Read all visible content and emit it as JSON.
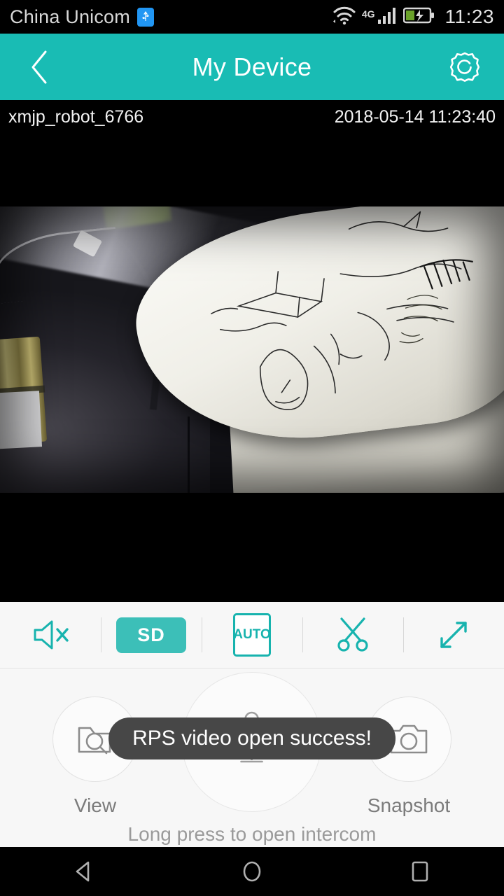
{
  "statusbar": {
    "carrier": "China Unicom",
    "usb_icon": "usb-icon",
    "wifi_icon": "wifi-icon",
    "network_type": "4G",
    "signal_icon": "cellular-signal-icon",
    "battery_icon": "battery-charging-icon",
    "clock": "11:23"
  },
  "header": {
    "back_icon": "back-chevron-icon",
    "title": "My Device",
    "settings_icon": "gear-icon",
    "accent_color": "#19bcb4"
  },
  "video": {
    "device_id": "xmjp_robot_6766",
    "timestamp": "2018-05-14 11:23:40"
  },
  "toolbar": {
    "items": [
      {
        "name": "mute-speaker-icon",
        "label": ""
      },
      {
        "name": "quality-sd-button",
        "label": "SD"
      },
      {
        "name": "auto-quality-button",
        "label": "AUTO"
      },
      {
        "name": "scissors-record-icon",
        "label": ""
      },
      {
        "name": "fullscreen-expand-icon",
        "label": ""
      }
    ],
    "sd_label": "SD",
    "auto_label": "AUTO",
    "accent_color": "#17b3ae",
    "sd_active_color": "#3cbfb8"
  },
  "bottom": {
    "view_label": "View",
    "view_icon": "folder-search-icon",
    "mic_icon": "microphone-icon",
    "mic_hint": "Long press to open intercom",
    "snapshot_label": "Snapshot",
    "snapshot_icon": "camera-icon"
  },
  "toast": {
    "message": "RPS video open success!",
    "background": "#474747"
  },
  "navbar": {
    "back_icon": "nav-back-triangle-icon",
    "home_icon": "nav-home-circle-icon",
    "recents_icon": "nav-recents-square-icon"
  }
}
